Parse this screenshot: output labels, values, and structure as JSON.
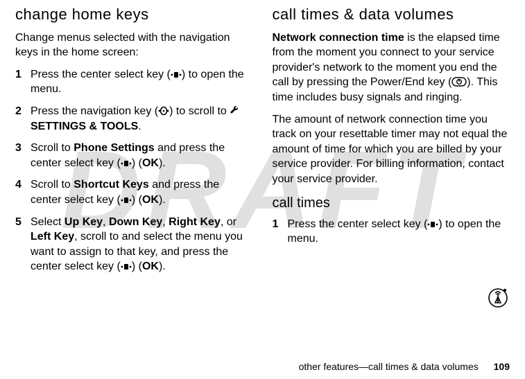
{
  "watermark": "DRAFT",
  "left": {
    "heading": "change home keys",
    "intro": "Change menus selected with the navigation keys in the home screen:",
    "steps": {
      "s1_a": "Press the center select key (",
      "s1_b": ") to open the menu.",
      "s2_a": "Press the navigation key (",
      "s2_b": ") to scroll to ",
      "s2_tool": " SETTINGS & TOOLS",
      "s2_c": ".",
      "s3_a": "Scroll to ",
      "s3_ps": "Phone Settings",
      "s3_b": " and press the center select key (",
      "s3_c": ") (",
      "s3_ok": "OK",
      "s3_d": ").",
      "s4_a": "Scroll to ",
      "s4_sk": "Shortcut Keys",
      "s4_b": " and press the center select key (",
      "s4_c": ") (",
      "s4_ok": "OK",
      "s4_d": ").",
      "s5_a": "Select ",
      "s5_up": "Up Key",
      "s5_c1": ", ",
      "s5_down": "Down Key",
      "s5_c2": ", ",
      "s5_right": "Right Key",
      "s5_c3": ", or ",
      "s5_left": "Left Key",
      "s5_b": ", scroll to and select the menu you want to assign to that key, and press the center select key (",
      "s5_c": ") (",
      "s5_ok": "OK",
      "s5_d": ")."
    }
  },
  "right": {
    "heading": "call times & data volumes",
    "p1_a": "Network connection time",
    "p1_b": " is the elapsed time from the moment you connect to your service provider's network to the moment you end the call by pressing the Power/End key (",
    "p1_c": "). This time includes busy signals and ringing.",
    "p2": "The amount of network connection time you track on your resettable timer may not equal the amount of time for which you are billed by your service provider. For billing information, contact your service provider.",
    "sub": "call times",
    "s1_a": "Press the center select key (",
    "s1_b": ") to open the menu."
  },
  "footer": {
    "text": "other features—call times & data volumes",
    "page": "109"
  },
  "nums": {
    "n1": "1",
    "n2": "2",
    "n3": "3",
    "n4": "4",
    "n5": "5"
  }
}
